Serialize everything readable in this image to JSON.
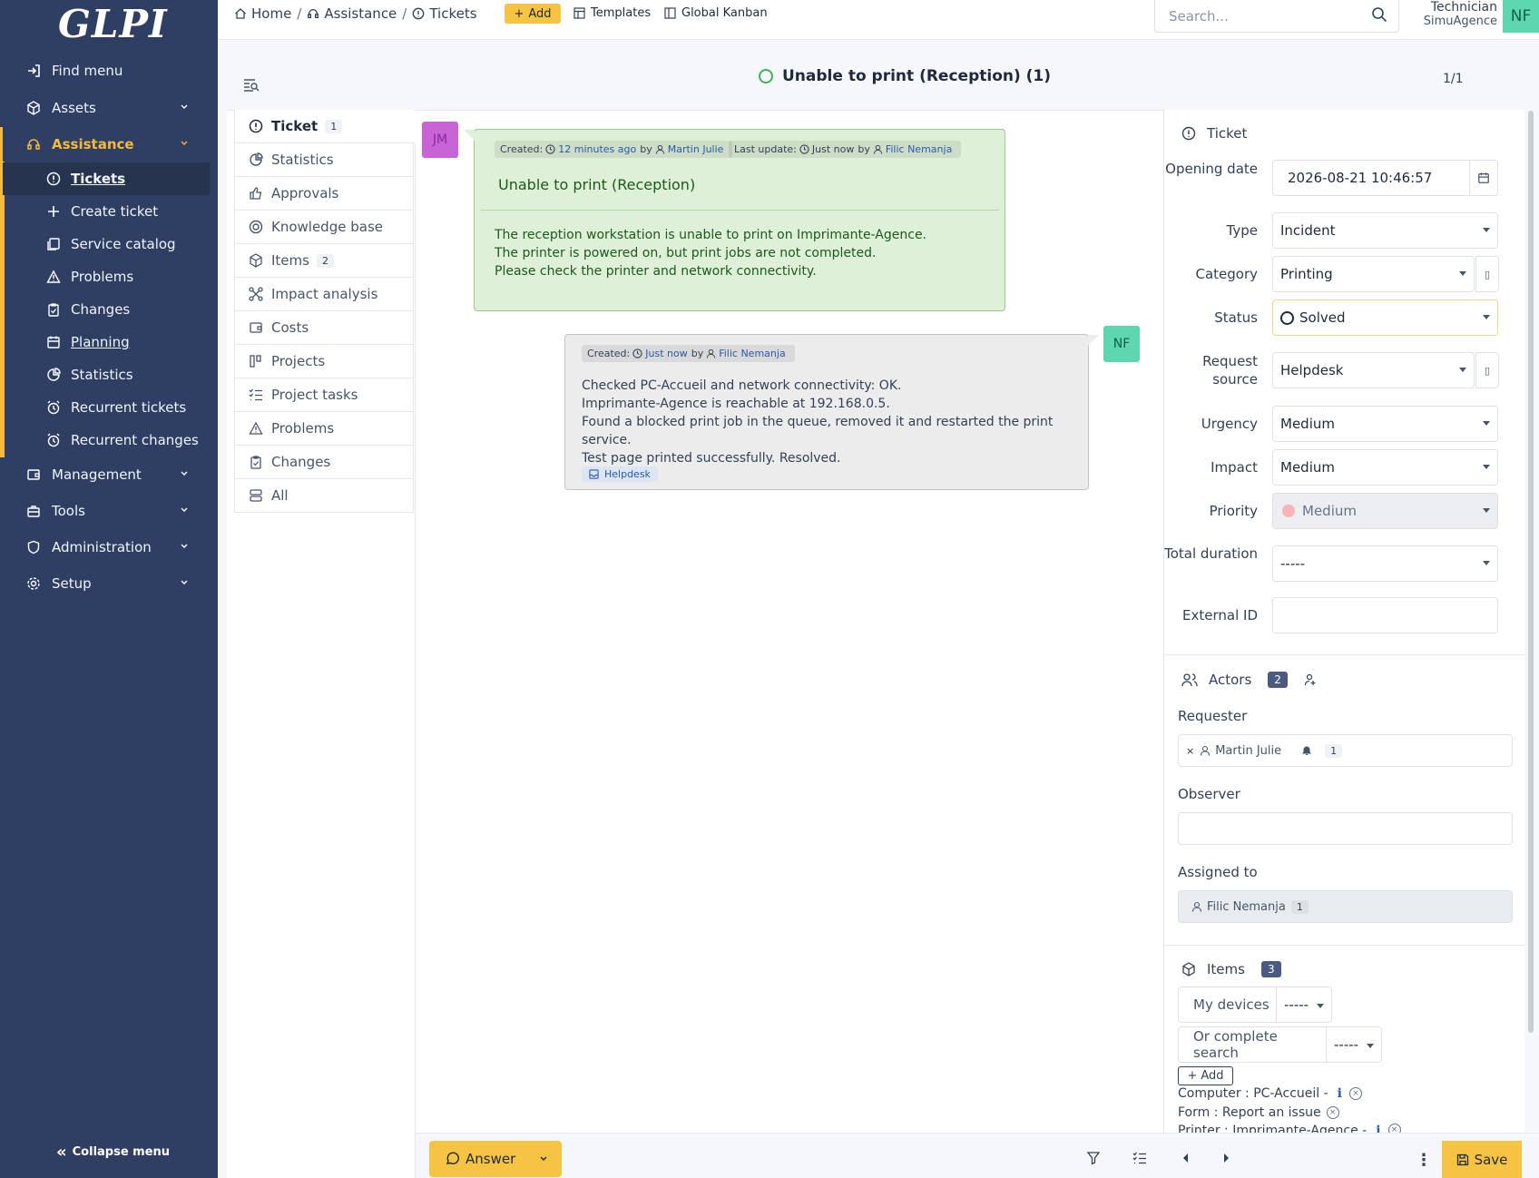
{
  "app": {
    "logo": "GLPI"
  },
  "sidebar": {
    "find_menu": "Find menu",
    "assets": "Assets",
    "assistance": "Assistance",
    "sub": {
      "tickets": "Tickets",
      "create_ticket": "Create ticket",
      "service_catalog": "Service catalog",
      "problems": "Problems",
      "changes": "Changes",
      "planning": "Planning",
      "statistics": "Statistics",
      "recurrent_tickets": "Recurrent tickets",
      "recurrent_changes": "Recurrent changes"
    },
    "management": "Management",
    "tools": "Tools",
    "administration": "Administration",
    "setup": "Setup",
    "collapse": "Collapse menu"
  },
  "topbar": {
    "breadcrumb": {
      "home": "Home",
      "assistance": "Assistance",
      "tickets": "Tickets"
    },
    "add": "Add",
    "templates": "Templates",
    "kanban": "Global Kanban",
    "search_placeholder": "Search...",
    "profile": "Technician",
    "entity": "SimuAgence",
    "initials": "NF"
  },
  "ticket": {
    "title": "Unable to print (Reception) (1)",
    "pager": "1/1"
  },
  "tabs": {
    "ticket": "Ticket",
    "ticket_count": "1",
    "statistics": "Statistics",
    "approvals": "Approvals",
    "knowledge_base": "Knowledge base",
    "items": "Items",
    "items_count": "2",
    "impact_analysis": "Impact analysis",
    "costs": "Costs",
    "projects": "Projects",
    "project_tasks": "Project tasks",
    "problems": "Problems",
    "changes": "Changes",
    "all": "All"
  },
  "timeline": {
    "first": {
      "initials": "JM",
      "created_label": "Created:",
      "created_when": "12 minutes ago",
      "by": "by",
      "author": "Martin Julie",
      "update_label": "Last update:",
      "update_when": "Just now",
      "update_by": "by",
      "update_author": "Filic Nemanja",
      "title": "Unable to print (Reception)",
      "line1": "The reception workstation is unable to print on Imprimante-Agence.",
      "line2": "The printer is powered on, but print jobs are not completed.",
      "line3": "Please check the printer and network connectivity."
    },
    "solution": {
      "initials": "NF",
      "created_label": "Created:",
      "created_when": "Just now",
      "by": "by",
      "author": "Filic Nemanja",
      "line1": "Checked PC-Accueil and network connectivity: OK.",
      "line2": "Imprimante-Agence is reachable at 192.168.0.5.",
      "line3": "Found a blocked print job in the queue, removed it and restarted the print service.",
      "line4": "Test page printed successfully. Resolved.",
      "source": "Helpdesk"
    }
  },
  "fields": {
    "section": "Ticket",
    "opening_date_label": "Opening date",
    "opening_date": "2026-08-21 10:46:57",
    "type_label": "Type",
    "type": "Incident",
    "category_label": "Category",
    "category": "Printing",
    "status_label": "Status",
    "status": "Solved",
    "request_source_label": "Request source",
    "request_source": "Helpdesk",
    "urgency_label": "Urgency",
    "urgency": "Medium",
    "impact_label": "Impact",
    "impact": "Medium",
    "priority_label": "Priority",
    "priority": "Medium",
    "total_duration_label": "Total duration",
    "total_duration": "-----",
    "external_id_label": "External ID",
    "external_id": ""
  },
  "actors": {
    "title": "Actors",
    "count": "2",
    "requester_label": "Requester",
    "requester": "Martin Julie",
    "requester_count": "1",
    "observer_label": "Observer",
    "assigned_label": "Assigned to",
    "assigned": "Filic Nemanja",
    "assigned_count": "1"
  },
  "items": {
    "title": "Items",
    "count": "3",
    "my_devices": "My devices",
    "dash1": "-----",
    "complete_search": "Or complete search",
    "dash2": "-----",
    "add": "Add",
    "item1": "Computer : PC-Accueil -",
    "item2": "Form : Report an issue",
    "item3": "Printer : Imprimante-Agence -"
  },
  "bottom": {
    "answer": "Answer",
    "save": "Save"
  },
  "colors": {
    "sidebar": "#2f3f64",
    "accent": "#f6c343",
    "followup_bg": "#dff0d8",
    "solution_bg": "#ececec"
  }
}
